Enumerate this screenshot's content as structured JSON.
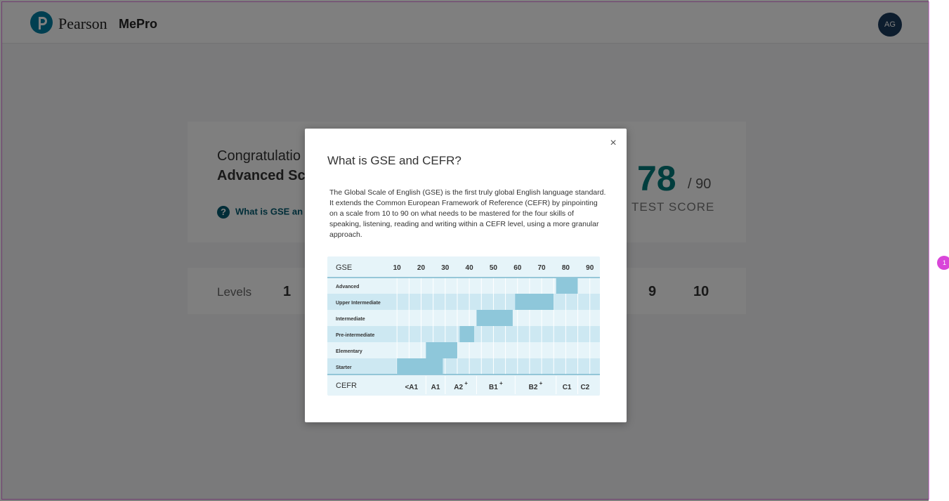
{
  "header": {
    "brand": "Pearson",
    "product": "MePro",
    "avatar_initials": "AG"
  },
  "score_card": {
    "congrats": "Congratulatio",
    "level_name": "Advanced Sc",
    "help_link": "What is GSE an",
    "score": "78",
    "score_max": "/ 90",
    "score_label": "TEST SCORE"
  },
  "levels_card": {
    "label": "Levels",
    "levels_visible": [
      "1",
      "9",
      "10"
    ]
  },
  "modal": {
    "title": "What is GSE and CEFR?",
    "close_label": "×",
    "description": "The Global Scale of English (GSE) is the first truly global English language standard. It extends the Common European Framework of Reference (CEFR) by pinpointing on a scale from 10 to 90 on what needs to be mastered for the four skills of speaking, listening, reading and writing within a CEFR level, using a more granular approach."
  },
  "chart_data": {
    "type": "table",
    "gse_label": "GSE",
    "cefr_label": "CEFR",
    "gse_ticks": [
      10,
      20,
      30,
      40,
      50,
      60,
      70,
      80,
      90
    ],
    "levels": [
      {
        "name": "Advanced",
        "gse_start": 76,
        "gse_end": 85
      },
      {
        "name": "Upper Intermediate",
        "gse_start": 59,
        "gse_end": 75
      },
      {
        "name": "Intermediate",
        "gse_start": 43,
        "gse_end": 58
      },
      {
        "name": "Pre-intermediate",
        "gse_start": 36,
        "gse_end": 42
      },
      {
        "name": "Elementary",
        "gse_start": 22,
        "gse_end": 35
      },
      {
        "name": "Starter",
        "gse_start": 10,
        "gse_end": 29
      }
    ],
    "cefr_bands": [
      {
        "label": "<A1",
        "start": 10,
        "end": 22
      },
      {
        "label": "A1",
        "start": 22,
        "end": 30
      },
      {
        "label": "A2+",
        "start": 30,
        "end": 43
      },
      {
        "label": "B1+",
        "start": 43,
        "end": 59
      },
      {
        "label": "B2+",
        "start": 59,
        "end": 76
      },
      {
        "label": "C1",
        "start": 76,
        "end": 85
      },
      {
        "label": "C2",
        "start": 85,
        "end": 91
      }
    ]
  },
  "colors": {
    "accent": "#007fa3",
    "score": "#007a7a",
    "chart_bg": "#e6f4f9",
    "chart_alt": "#cde8f2",
    "chart_bar": "#8ec7da"
  },
  "side_bubble": "1"
}
